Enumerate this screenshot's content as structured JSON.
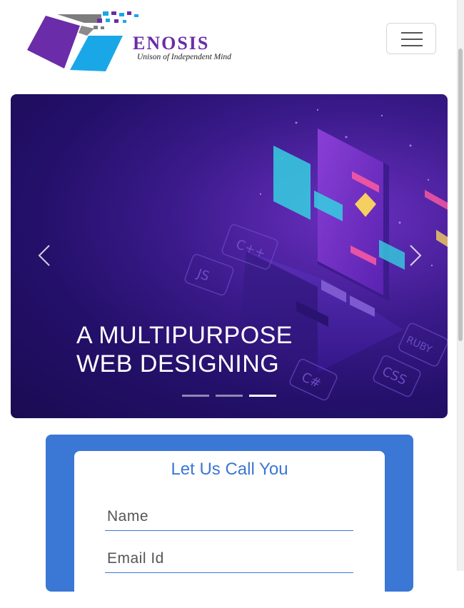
{
  "brand": {
    "name": "Enosis",
    "tagline": "Unison of Independent Mind",
    "colors": {
      "purple": "#6a2ca8",
      "blue": "#1aa7e8",
      "gray": "#7d7d7d"
    }
  },
  "nav": {
    "toggle_icon": "hamburger-menu-icon"
  },
  "hero": {
    "caption_line1": "A MULTIPURPOSE",
    "caption_line2": "WEB DESIGNING",
    "prev_icon": "chevron-left-icon",
    "next_icon": "chevron-right-icon",
    "slide_count": 3,
    "active_slide": 3,
    "art_labels": [
      "JS",
      "C++",
      "C#",
      "CSS",
      "RUBY"
    ]
  },
  "callback": {
    "title": "Let Us Call You",
    "name_placeholder": "Name",
    "email_placeholder": "Email Id",
    "accent_color": "#3b77d4"
  }
}
